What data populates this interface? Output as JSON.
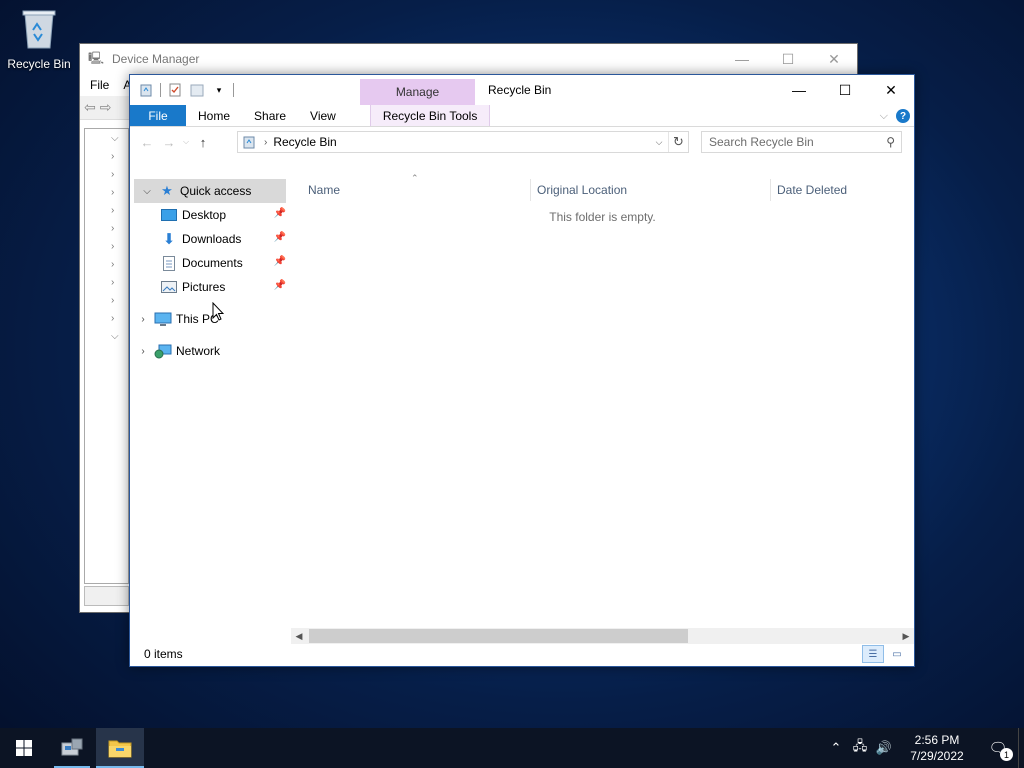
{
  "desktop": {
    "recycle_bin_label": "Recycle Bin"
  },
  "device_manager": {
    "title": "Device Manager",
    "menu": [
      "File",
      "A"
    ]
  },
  "explorer": {
    "manage_tab": "Manage",
    "title": "Recycle Bin",
    "ribbon_tabs": {
      "file": "File",
      "home": "Home",
      "share": "Share",
      "view": "View",
      "tools": "Recycle Bin Tools"
    },
    "address": {
      "crumb": "Recycle Bin"
    },
    "search": {
      "placeholder": "Search Recycle Bin"
    },
    "nav": {
      "quick_access": "Quick access",
      "pinned": [
        {
          "label": "Desktop"
        },
        {
          "label": "Downloads"
        },
        {
          "label": "Documents"
        },
        {
          "label": "Pictures"
        }
      ],
      "this_pc": "This PC",
      "network": "Network"
    },
    "columns": {
      "name": "Name",
      "original_location": "Original Location",
      "date_deleted": "Date Deleted"
    },
    "empty_message": "This folder is empty.",
    "status": {
      "items": "0 items"
    }
  },
  "taskbar": {
    "clock": {
      "time": "2:56 PM",
      "date": "7/29/2022"
    },
    "notification_count": "1"
  },
  "colors": {
    "accent": "#1979ca",
    "manage_tab": "#e6c9f0",
    "taskbar": "#0c1424"
  }
}
